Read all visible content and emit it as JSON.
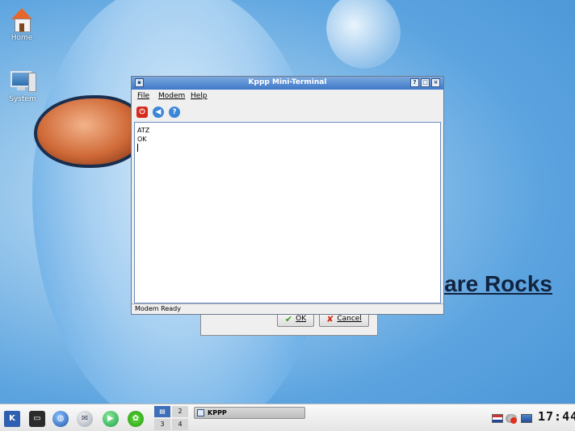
{
  "desktop": {
    "wallpaper_text": "are Rocks",
    "icons": [
      {
        "label": "Home",
        "icon": "home-icon"
      },
      {
        "label": "System",
        "icon": "computer-icon"
      }
    ]
  },
  "window": {
    "title": "Kppp Mini-Terminal",
    "title_buttons": [
      "?",
      "□",
      "×"
    ],
    "menu": {
      "file": "File",
      "modem": "Modem",
      "help": "Help"
    },
    "toolbar": [
      {
        "name": "hangup",
        "icon": "power-icon"
      },
      {
        "name": "back",
        "icon": "back-arrow-icon"
      },
      {
        "name": "help",
        "icon": "help-icon"
      }
    ],
    "terminal_lines": [
      "ATZ",
      "OK"
    ],
    "status": "Modem Ready"
  },
  "behind_dialog": {
    "ok_label": "OK",
    "cancel_label": "Cancel"
  },
  "taskbar": {
    "pager": [
      "1",
      "2",
      "3",
      "4"
    ],
    "active_task": "KPPP",
    "clock": "17:44",
    "tray": [
      "keyboard-layout-icon",
      "volume-muted-icon",
      "network-icon"
    ]
  },
  "colors": {
    "titlebar": "#3f78c9",
    "desktop": "#5ca4e0",
    "accent": "#3e6fb8"
  }
}
